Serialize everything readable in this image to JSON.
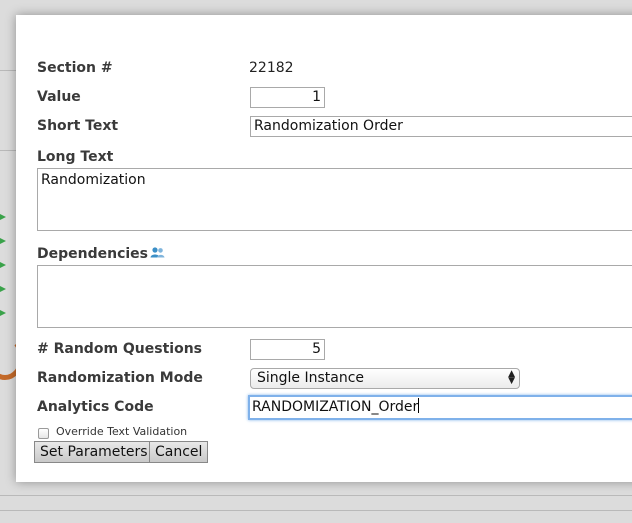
{
  "section": {
    "label": "Section #",
    "value": "22182"
  },
  "value_field": {
    "label": "Value",
    "value": "1"
  },
  "short_text": {
    "label": "Short Text",
    "value": "Randomization Order"
  },
  "long_text": {
    "label": "Long Text",
    "value": "Randomization"
  },
  "dependencies": {
    "label": "Dependencies",
    "icon": "users-icon",
    "value": ""
  },
  "random_questions": {
    "label": "# Random Questions",
    "value": "5"
  },
  "randomization_mode": {
    "label": "Randomization Mode",
    "selected": "Single Instance"
  },
  "analytics_code": {
    "label": "Analytics Code",
    "value": "RANDOMIZATION_Order"
  },
  "override": {
    "label": "Override Text Validation",
    "checked": false
  },
  "buttons": {
    "set_parameters": "Set Parameters",
    "cancel": "Cancel"
  },
  "colors": {
    "focus_ring": "#7fb1ea",
    "dialog_bg": "#ffffff",
    "icon_blue": "#3b8fc7"
  }
}
